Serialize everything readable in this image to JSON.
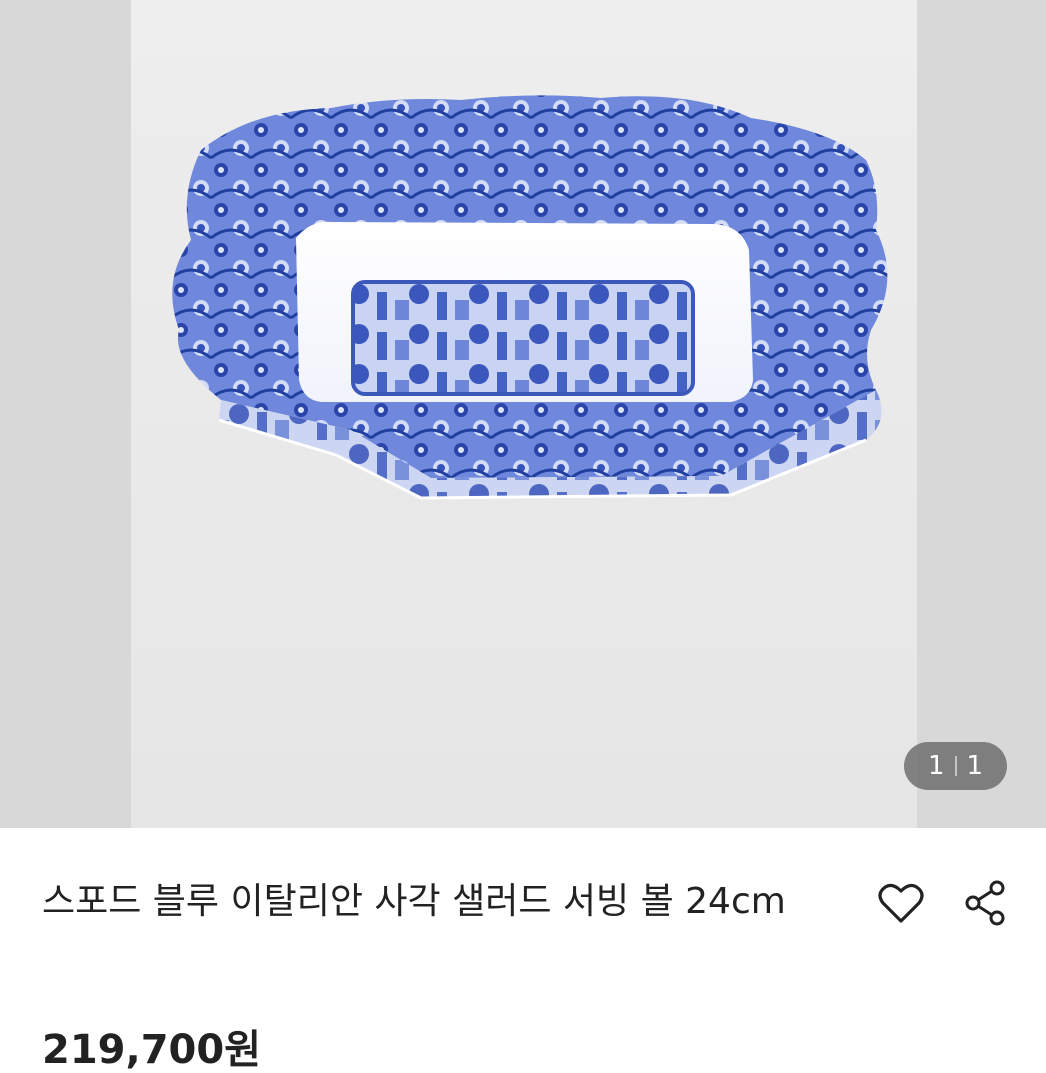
{
  "gallery": {
    "image_alt": "스포드 블루 이탈리안 사각 샐러드 서빙 볼",
    "counter_current": "1",
    "counter_total": "1"
  },
  "product": {
    "title": "스포드 블루 이탈리안 사각 샐러드 서빙 볼 24cm",
    "price": "219,700원"
  },
  "icons": {
    "like": "heart-icon",
    "share": "share-icon"
  },
  "colors": {
    "pattern_blue": "#2f4fb5",
    "pattern_light": "#8ea3e2"
  }
}
